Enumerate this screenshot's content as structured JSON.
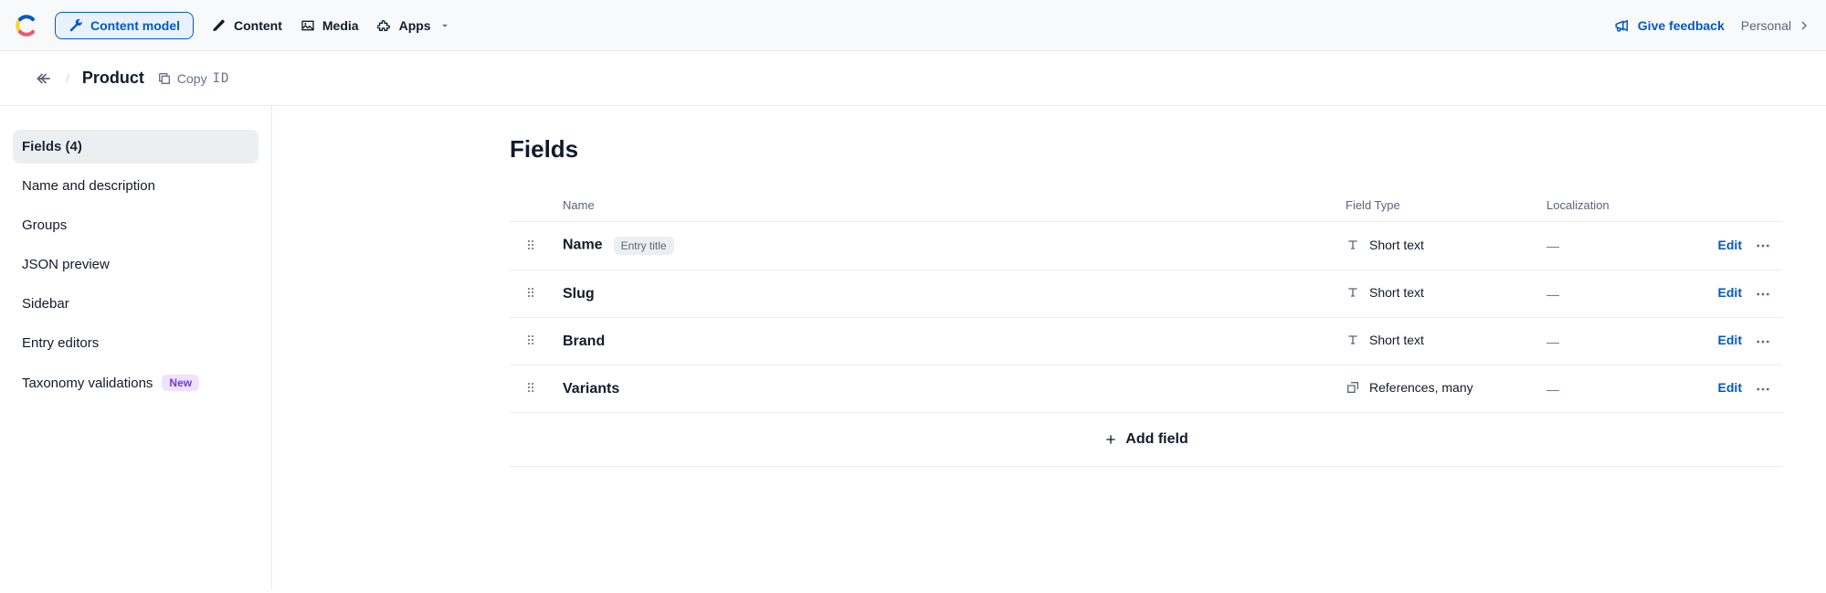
{
  "nav": {
    "content_model": "Content model",
    "content": "Content",
    "media": "Media",
    "apps": "Apps",
    "feedback": "Give feedback",
    "space": "Personal"
  },
  "crumb": {
    "title": "Product",
    "copy": "Copy",
    "id": "ID"
  },
  "sidebar": {
    "items": [
      {
        "label": "Fields (4)",
        "active": true
      },
      {
        "label": "Name and description"
      },
      {
        "label": "Groups"
      },
      {
        "label": "JSON preview"
      },
      {
        "label": "Sidebar"
      },
      {
        "label": "Entry editors"
      },
      {
        "label": "Taxonomy validations",
        "badge": "New"
      }
    ]
  },
  "page": {
    "title": "Fields",
    "columns": {
      "name": "Name",
      "type": "Field Type",
      "loc": "Localization"
    },
    "entry_title_badge": "Entry title",
    "loc_dash": "—",
    "edit": "Edit",
    "add_field": "Add field",
    "fields": [
      {
        "name": "Name",
        "type": "Short text",
        "type_icon": "text",
        "entry_title": true
      },
      {
        "name": "Slug",
        "type": "Short text",
        "type_icon": "text"
      },
      {
        "name": "Brand",
        "type": "Short text",
        "type_icon": "text"
      },
      {
        "name": "Variants",
        "type": "References, many",
        "type_icon": "ref"
      }
    ]
  }
}
